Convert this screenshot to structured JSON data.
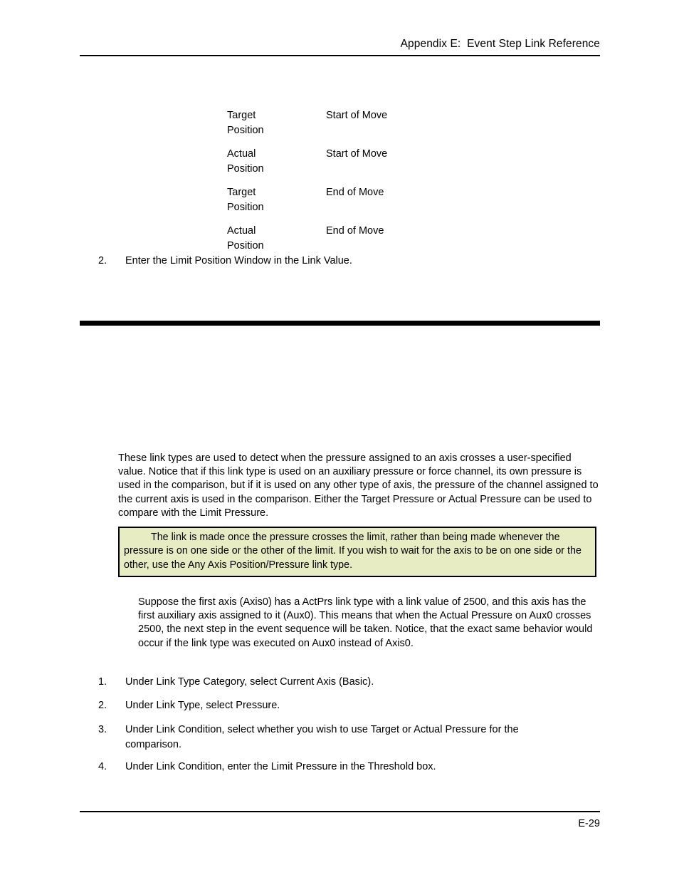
{
  "header": {
    "title": "Appendix E:  Event Step Link Reference"
  },
  "definition_table": {
    "rows": [
      {
        "term_line1": "Target",
        "term_line2": "Position",
        "value": "Start of Move"
      },
      {
        "term_line1": "Actual",
        "term_line2": "Position",
        "value": "Start of Move"
      },
      {
        "term_line1": "Target",
        "term_line2": "Position",
        "value": "End of Move"
      },
      {
        "term_line1": "Actual",
        "term_line2": "Position",
        "value": "End of Move"
      }
    ]
  },
  "step_limit_position": {
    "number": "2.",
    "text": "Enter the Limit Position Window in the Link Value."
  },
  "intro_paragraph": "These link types are used to detect when the pressure assigned to an axis crosses a user-specified value. Notice that if this link type is used on an auxiliary pressure or force channel, its own pressure is used in the comparison, but if it is used on any other type of axis, the pressure of the channel assigned to the current axis is used in the comparison. Either the Target Pressure or Actual Pressure can be used to compare with the Limit Pressure.",
  "note_box": {
    "background_color": "#e8ecc2",
    "border_color": "#000000",
    "text": "The link is made once the pressure crosses the limit, rather than being made whenever the pressure is on one side or the other of the limit. If you wish to wait for the axis to be on one side or the other, use the Any Axis Position/Pressure link type."
  },
  "example_paragraph": "Suppose the first axis (Axis0) has a ActPrs link type with a link value of 2500, and this axis has the first auxiliary axis assigned to it (Aux0). This means that when the Actual Pressure on Aux0 crosses 2500, the next step in the event sequence will be taken. Notice, that the exact same behavior would occur if the link type was executed on Aux0 instead of Axis0.",
  "procedure": [
    {
      "number": "1.",
      "text": "Under Link Type Category, select Current Axis (Basic)."
    },
    {
      "number": "2.",
      "text": "Under Link Type, select Pressure."
    },
    {
      "number": "3.",
      "text": "Under Link Condition, select whether you wish to use Target or Actual Pressure for the comparison."
    },
    {
      "number": "4.",
      "text": "Under Link Condition, enter the Limit Pressure in the Threshold box."
    }
  ],
  "footer": {
    "page_number": "E-29"
  }
}
